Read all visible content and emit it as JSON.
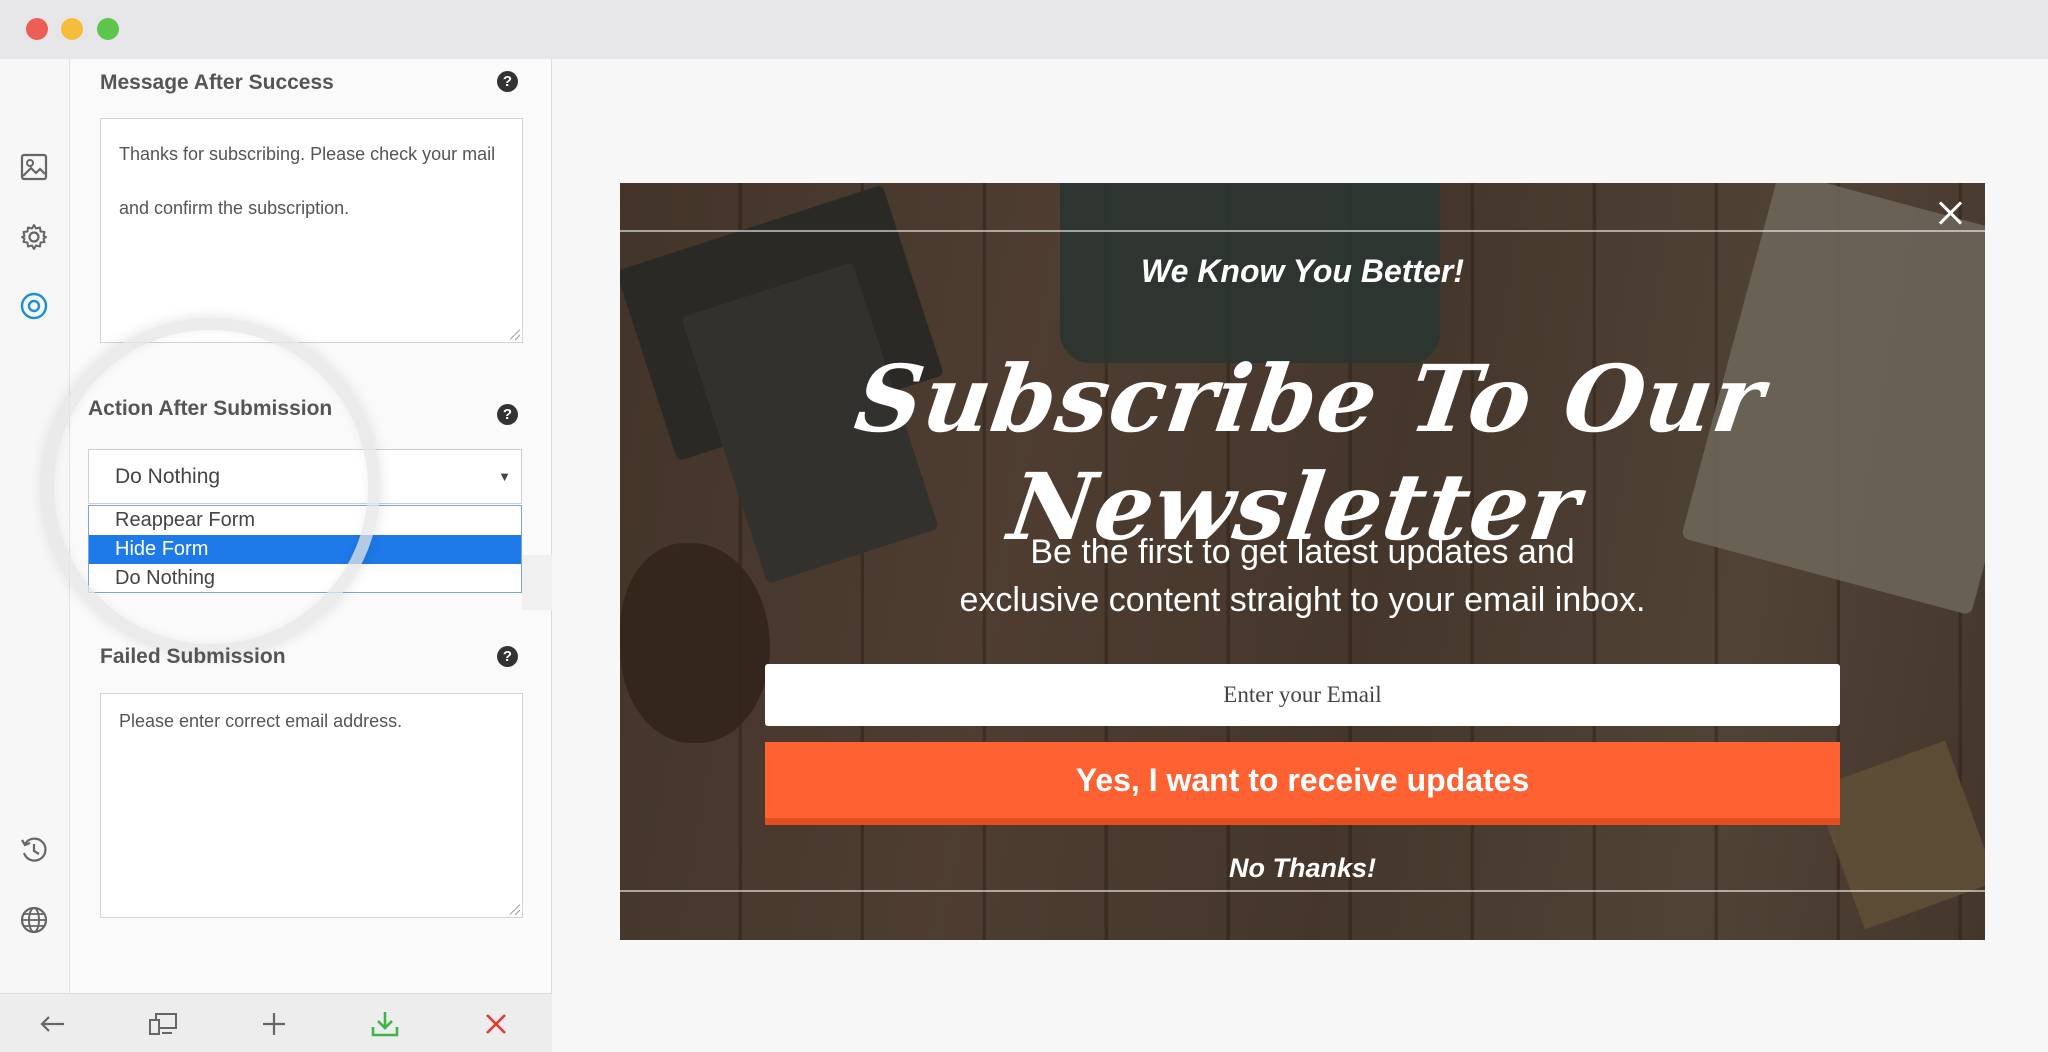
{
  "window": {
    "controls": [
      "close",
      "minimize",
      "maximize"
    ]
  },
  "rail": {
    "items": [
      {
        "icon": "image-icon"
      },
      {
        "icon": "gear-icon"
      },
      {
        "icon": "target-icon",
        "active": true
      },
      {
        "icon": "history-icon"
      },
      {
        "icon": "globe-icon"
      }
    ]
  },
  "panel": {
    "success": {
      "label": "Message After Success",
      "value": "Thanks for subscribing. Please check your mail and confirm the subscription."
    },
    "action": {
      "label": "Action After Submission",
      "selected": "Do Nothing",
      "options": [
        "Reappear Form",
        "Hide Form",
        "Do Nothing"
      ],
      "highlighted": "Hide Form"
    },
    "failed": {
      "label": "Failed Submission",
      "value": "Please enter correct email address."
    },
    "help_glyph": "?"
  },
  "bottombar": {
    "buttons": [
      "back-arrow-icon",
      "responsive-preview-icon",
      "plus-icon",
      "download-icon",
      "close-icon"
    ]
  },
  "popup": {
    "kicker": "We Know You Better!",
    "headline": "Subscribe To Our Newsletter",
    "subtitle_line1": "Be the first to get latest updates and",
    "subtitle_line2": "exclusive content straight to your email inbox.",
    "email_placeholder": "Enter your Email",
    "cta_label": "Yes, I want to receive updates",
    "decline_label": "No Thanks!"
  },
  "colors": {
    "accent": "#1e7ae8",
    "cta": "#ff6232",
    "download": "#3db54a",
    "delete": "#e53935"
  }
}
